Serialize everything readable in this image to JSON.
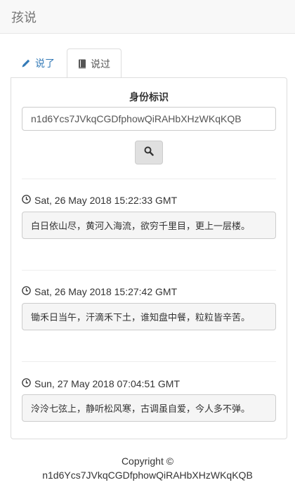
{
  "navbar": {
    "brand": "孩说"
  },
  "tabs": [
    {
      "label": "说了",
      "icon": "pencil-icon"
    },
    {
      "label": "说过",
      "icon": "book-icon",
      "active": true
    }
  ],
  "identity": {
    "label": "身份标识",
    "value": "n1d6Ycs7JVkqCGDfphowQiRAHbXHzWKqKQB"
  },
  "search": {
    "icon": "search-icon"
  },
  "entries": [
    {
      "time": "Sat, 26 May 2018 15:22:33 GMT",
      "text": "白日依山尽，黄河入海流，欲穷千里目，更上一层楼。"
    },
    {
      "time": "Sat, 26 May 2018 15:27:42 GMT",
      "text": "锄禾日当午，汗滴禾下土，谁知盘中餐，粒粒皆辛苦。"
    },
    {
      "time": "Sun, 27 May 2018 07:04:51 GMT",
      "text": "泠泠七弦上，静听松风寒，古调虽自爱，今人多不弹。"
    }
  ],
  "footer": {
    "line1": "Copyright ©",
    "line2": "n1d6Ycs7JVkqCGDfphowQiRAHbXHzWKqKQB"
  },
  "colors": {
    "link": "#337ab7",
    "navbar_bg": "#f8f8f8",
    "well_bg": "#f5f5f5"
  }
}
